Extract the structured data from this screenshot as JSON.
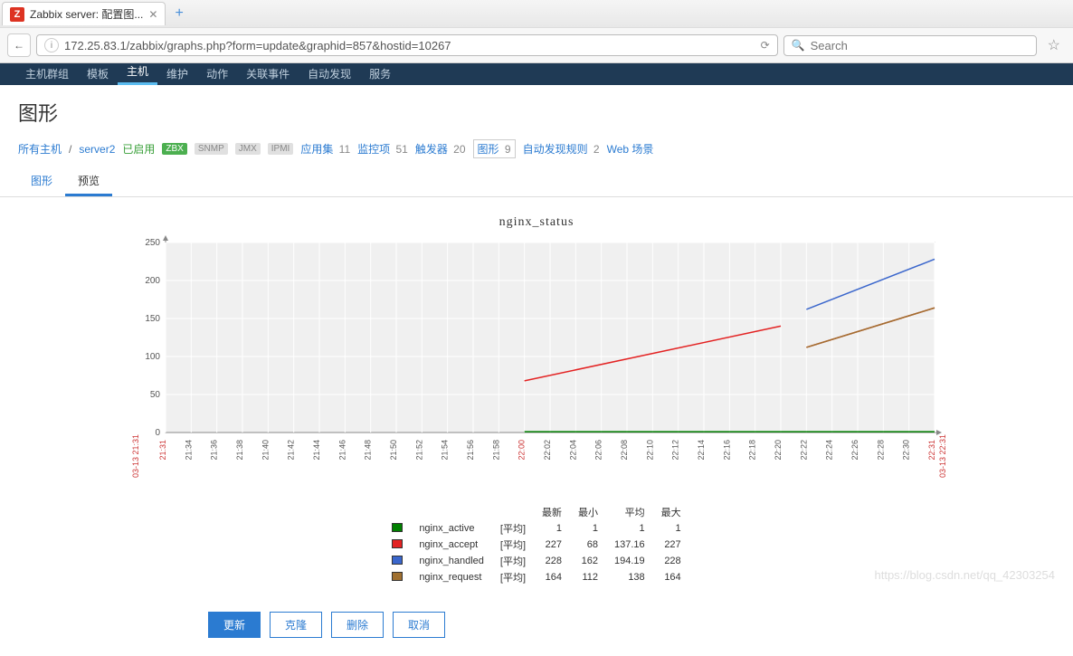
{
  "browser": {
    "tab_title": "Zabbix server: 配置图...",
    "url": "172.25.83.1/zabbix/graphs.php?form=update&graphid=857&hostid=10267",
    "search_placeholder": "Search"
  },
  "top_nav": [
    "主机群组",
    "模板",
    "主机",
    "维护",
    "动作",
    "关联事件",
    "自动发现",
    "服务"
  ],
  "top_nav_active_index": 2,
  "page_title": "图形",
  "breadcrumb": {
    "all_hosts": "所有主机",
    "host": "server2",
    "enabled": "已启用",
    "zbx": "ZBX",
    "off_badges": [
      "SNMP",
      "JMX",
      "IPMI"
    ],
    "links": [
      {
        "label": "应用集",
        "count": "11"
      },
      {
        "label": "监控项",
        "count": "51"
      },
      {
        "label": "触发器",
        "count": "20"
      },
      {
        "label": "图形",
        "count": "9",
        "boxed": true
      },
      {
        "label": "自动发现规则",
        "count": "2"
      },
      {
        "label": "Web 场景",
        "count": ""
      }
    ]
  },
  "sub_tabs": [
    "图形",
    "预览"
  ],
  "sub_tab_active": 1,
  "chart_data": {
    "type": "line",
    "title": "nginx_status",
    "ylim": [
      0,
      250
    ],
    "yticks": [
      0,
      50,
      100,
      150,
      200,
      250
    ],
    "x_start": "03-13 21:31",
    "x_end": "03-13 22:31",
    "xticks": [
      "21:31",
      "21:34",
      "21:36",
      "21:38",
      "21:40",
      "21:42",
      "21:44",
      "21:46",
      "21:48",
      "21:50",
      "21:52",
      "21:54",
      "21:56",
      "21:58",
      "22:00",
      "22:02",
      "22:04",
      "22:06",
      "22:08",
      "22:10",
      "22:12",
      "22:14",
      "22:16",
      "22:18",
      "22:20",
      "22:22",
      "22:24",
      "22:26",
      "22:28",
      "22:30",
      "22:31"
    ],
    "series": [
      {
        "name": "nginx_active",
        "color": "#008000",
        "segments": [
          {
            "xi": 14,
            "yi": 1,
            "xf": 30,
            "yf": 1
          }
        ]
      },
      {
        "name": "nginx_accept",
        "color": "#e32222",
        "segments": [
          {
            "xi": 14,
            "yi": 68,
            "xf": 24,
            "yf": 140
          },
          {
            "xi": 25,
            "yi": 112,
            "xf": 30,
            "yf": 164
          }
        ]
      },
      {
        "name": "nginx_handled",
        "color": "#3a66cc",
        "segments": [
          {
            "xi": 25,
            "yi": 162,
            "xf": 30,
            "yf": 228
          }
        ]
      },
      {
        "name": "nginx_request",
        "color": "#a07030",
        "segments": [
          {
            "xi": 25,
            "yi": 112,
            "xf": 30,
            "yf": 164
          }
        ]
      }
    ],
    "legend_headers": [
      "",
      "",
      "",
      "最新",
      "最小",
      "平均",
      "最大"
    ],
    "legend": [
      {
        "color": "#008000",
        "name": "nginx_active",
        "agg": "[平均]",
        "latest": "1",
        "min": "1",
        "avg": "1",
        "max": "1"
      },
      {
        "color": "#e32222",
        "name": "nginx_accept",
        "agg": "[平均]",
        "latest": "227",
        "min": "68",
        "avg": "137.16",
        "max": "227"
      },
      {
        "color": "#3a66cc",
        "name": "nginx_handled",
        "agg": "[平均]",
        "latest": "228",
        "min": "162",
        "avg": "194.19",
        "max": "228"
      },
      {
        "color": "#a07030",
        "name": "nginx_request",
        "agg": "[平均]",
        "latest": "164",
        "min": "112",
        "avg": "138",
        "max": "164"
      }
    ]
  },
  "buttons": {
    "update": "更新",
    "clone": "克隆",
    "delete": "删除",
    "cancel": "取消"
  },
  "watermark": "https://blog.csdn.net/qq_42303254"
}
